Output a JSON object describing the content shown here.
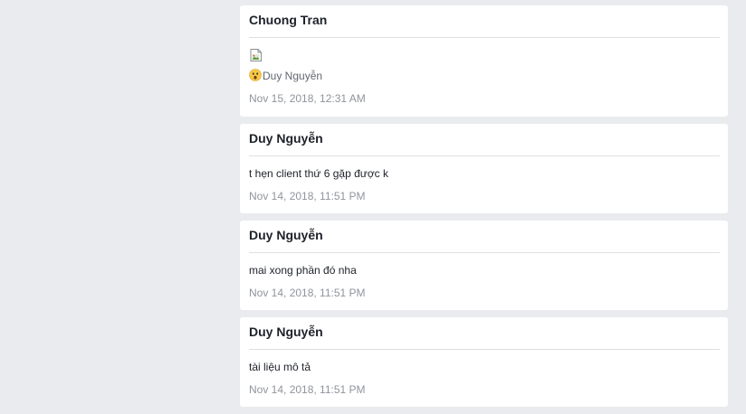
{
  "messages": [
    {
      "author": "Chuong Tran",
      "image_alt": "",
      "emoji_icon": "astonished-face-icon",
      "text": "Duy Nguyễn",
      "time": "Nov 15, 2018, 12:31 AM"
    },
    {
      "author": "Duy Nguyễn",
      "text": "t hẹn client thứ 6 gặp được k",
      "time": "Nov 14, 2018, 11:51 PM"
    },
    {
      "author": "Duy Nguyễn",
      "text": "mai xong phần đó nha",
      "time": "Nov 14, 2018, 11:51 PM"
    },
    {
      "author": "Duy Nguyễn",
      "text": "tài liệu mô tả",
      "time": "Nov 14, 2018, 11:51 PM"
    }
  ]
}
